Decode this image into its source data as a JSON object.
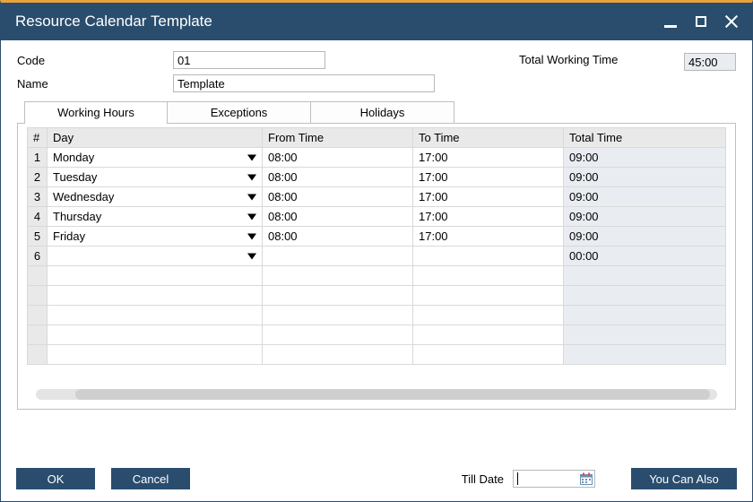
{
  "window": {
    "title": "Resource Calendar Template"
  },
  "form": {
    "code_label": "Code",
    "code_value": "01",
    "name_label": "Name",
    "name_value": "Template",
    "total_label": "Total Working Time",
    "total_value": "45:00"
  },
  "tabs": {
    "working_hours": "Working Hours",
    "exceptions": "Exceptions",
    "holidays": "Holidays"
  },
  "grid": {
    "headers": {
      "num": "#",
      "day": "Day",
      "from": "From Time",
      "to": "To Time",
      "total": "Total Time"
    },
    "rows": [
      {
        "n": "1",
        "day": "Monday",
        "from": "08:00",
        "to": "17:00",
        "total": "09:00"
      },
      {
        "n": "2",
        "day": "Tuesday",
        "from": "08:00",
        "to": "17:00",
        "total": "09:00"
      },
      {
        "n": "3",
        "day": "Wednesday",
        "from": "08:00",
        "to": "17:00",
        "total": "09:00"
      },
      {
        "n": "4",
        "day": "Thursday",
        "from": "08:00",
        "to": "17:00",
        "total": "09:00"
      },
      {
        "n": "5",
        "day": "Friday",
        "from": "08:00",
        "to": "17:00",
        "total": "09:00"
      },
      {
        "n": "6",
        "day": "",
        "from": "",
        "to": "",
        "total": "00:00"
      }
    ]
  },
  "footer": {
    "ok": "OK",
    "cancel": "Cancel",
    "till_date_label": "Till Date",
    "till_date_value": "",
    "you_can_also": "You Can Also"
  }
}
